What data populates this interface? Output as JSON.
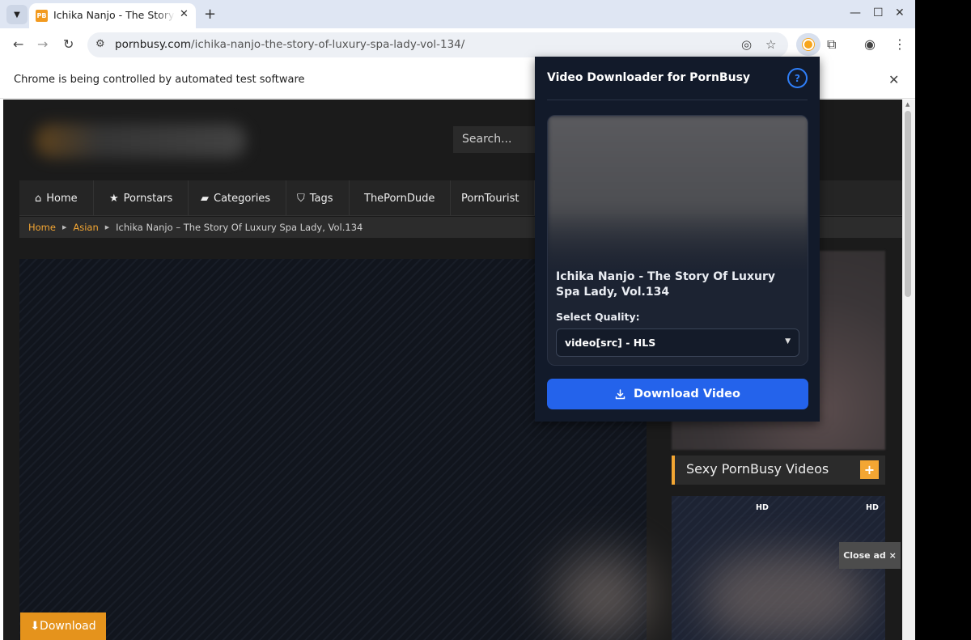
{
  "browser": {
    "tab_title": "Ichika Nanjo - The Story Of Luxury Spa Lady, Vol.134",
    "favicon_text": "PB",
    "url_host": "pornbusy.com",
    "url_path": "/ichika-nanjo-the-story-of-luxury-spa-lady-vol-134/",
    "infobar_text": "Chrome is being controlled by automated test software"
  },
  "site": {
    "search_placeholder": "Search...",
    "nav": [
      "Home",
      "Pornstars",
      "Categories",
      "Tags",
      "ThePornDude",
      "PornTourist"
    ],
    "breadcrumb": {
      "home": "Home",
      "category": "Asian",
      "current": "Ichika Nanjo – The Story Of Luxury Spa Lady, Vol.134"
    },
    "download_button": "⬇Download",
    "sidebar_title": "Sexy PornBusy Videos",
    "sidebar_plus": "+",
    "hd_badge": "HD",
    "close_ad": "Close ad ×"
  },
  "popup": {
    "title": "Video Downloader for PornBusy",
    "help": "?",
    "video_title": "Ichika Nanjo - The Story Of Luxury Spa Lady, Vol.134",
    "quality_label": "Select Quality:",
    "quality_selected": "video[src] - HLS",
    "download_label": "Download Video"
  },
  "colors": {
    "accent": "#f3a633",
    "popup_bg": "#121a2a",
    "primary_button": "#2463eb"
  }
}
